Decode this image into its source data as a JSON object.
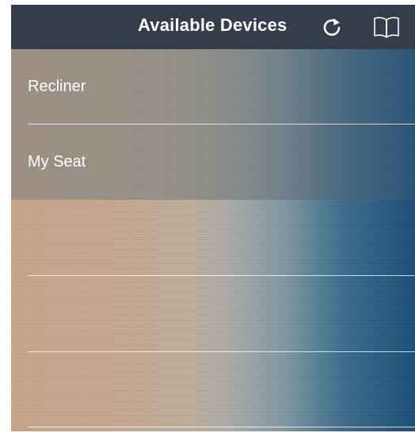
{
  "header": {
    "title": "Available Devices",
    "icons": {
      "refresh": "refresh-icon",
      "guide": "book-icon"
    }
  },
  "devices": [
    {
      "label": "Recliner"
    },
    {
      "label": "My Seat"
    }
  ],
  "colors": {
    "navbar": "#343d4a",
    "gradient_left": "#c9a68a",
    "gradient_right": "#1c5077",
    "text": "#ffffff"
  }
}
